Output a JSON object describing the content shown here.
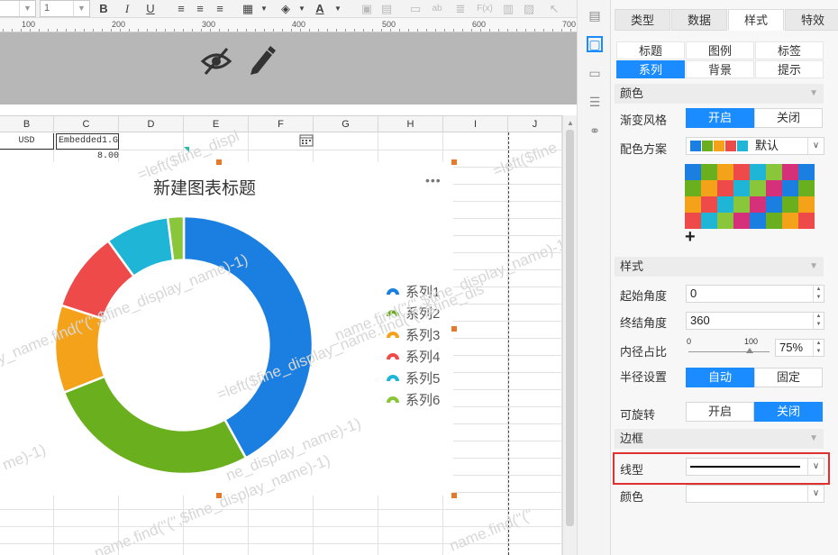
{
  "toolbar": {
    "font_size": "1",
    "bold": "B",
    "italic": "I",
    "underline": "U",
    "font_color": "A",
    "fx": "F(x)",
    "ab": "ab"
  },
  "ruler": {
    "marks": [
      "100",
      "200",
      "300",
      "400",
      "500",
      "600",
      "700"
    ]
  },
  "columns": [
    "B",
    "C",
    "D",
    "E",
    "F",
    "G",
    "H",
    "I",
    "J"
  ],
  "cells": {
    "b_value": "USD",
    "c_value": "Embedded1.G",
    "c_row2": "8.00"
  },
  "chart": {
    "title": "新建图表标题",
    "more": "•••",
    "legend": [
      {
        "name": "系列1",
        "color": "#1a7fe0"
      },
      {
        "name": "系列2",
        "color": "#6ab01e"
      },
      {
        "name": "系列3",
        "color": "#f5a21b"
      },
      {
        "name": "系列4",
        "color": "#ef4a4a"
      },
      {
        "name": "系列5",
        "color": "#1eb5d6"
      },
      {
        "name": "系列6",
        "color": "#89c63a"
      }
    ],
    "watermarks": [
      "=left($fine_displ",
      "=left($fine",
      "y_name.find(\"(\",$fine_display_name)-1)",
      "_name.find(\"(\",$fine_display_name)-1)",
      "=left($fine_display_name.find(\"(\",$fine_dis",
      "me)-1)",
      "ne_display_name)-1)",
      "name.find(\"(\",$fine_display_name)-1)",
      "name.find(\"(\""
    ]
  },
  "chart_data": {
    "type": "pie",
    "title": "新建图表标题",
    "categories": [
      "系列1",
      "系列2",
      "系列3",
      "系列4",
      "系列5",
      "系列6"
    ],
    "values": [
      42,
      27,
      11,
      10,
      8,
      2
    ],
    "inner_radius_percent": 75,
    "start_angle": 0,
    "end_angle": 360,
    "legend_position": "right"
  },
  "panel": {
    "tabs": [
      {
        "label": "类型",
        "active": false
      },
      {
        "label": "数据",
        "active": false
      },
      {
        "label": "样式",
        "active": true
      },
      {
        "label": "特效",
        "active": false
      }
    ],
    "subtabs": [
      {
        "label": "标题",
        "active": false
      },
      {
        "label": "图例",
        "active": false
      },
      {
        "label": "标签",
        "active": false
      },
      {
        "label": "系列",
        "active": true
      },
      {
        "label": "背景",
        "active": false
      },
      {
        "label": "提示",
        "active": false
      }
    ],
    "color_section": "颜色",
    "gradient_label": "渐变风格",
    "gradient_on": "开启",
    "gradient_off": "关闭",
    "scheme_label": "配色方案",
    "scheme_value": "默认",
    "scheme_swatches": [
      "#1a7fe0",
      "#6ab01e",
      "#f5a21b",
      "#ef4a4a",
      "#1eb5d6"
    ],
    "palette": [
      [
        "#1a7fe0",
        "#6ab01e",
        "#f5a21b",
        "#ef4a4a",
        "#1eb5d6",
        "#89c63a",
        "#d6307a",
        "#1a7fe0"
      ],
      [
        "#6ab01e",
        "#f5a21b",
        "#ef4a4a",
        "#1eb5d6",
        "#89c63a",
        "#d6307a",
        "#1a7fe0",
        "#6ab01e"
      ],
      [
        "#f5a21b",
        "#ef4a4a",
        "#1eb5d6",
        "#89c63a",
        "#d6307a",
        "#1a7fe0",
        "#6ab01e",
        "#f5a21b"
      ],
      [
        "#ef4a4a",
        "#1eb5d6",
        "#89c63a",
        "#d6307a",
        "#1a7fe0",
        "#6ab01e",
        "#f5a21b",
        "#ef4a4a"
      ]
    ],
    "add_label": "+",
    "style_section": "样式",
    "start_angle_label": "起始角度",
    "start_angle_value": "0",
    "end_angle_label": "终结角度",
    "end_angle_value": "360",
    "inner_ratio_label": "内径占比",
    "slider_min": "0",
    "slider_max": "100",
    "inner_ratio_value": "75%",
    "inner_ratio_fraction": 0.75,
    "radius_label": "半径设置",
    "radius_auto": "自动",
    "radius_fixed": "固定",
    "rotate_label": "可旋转",
    "rotate_on": "开启",
    "rotate_off": "关闭",
    "border_section": "边框",
    "line_type_label": "线型",
    "border_color_label": "颜色",
    "highlight_color": "#e03030"
  }
}
